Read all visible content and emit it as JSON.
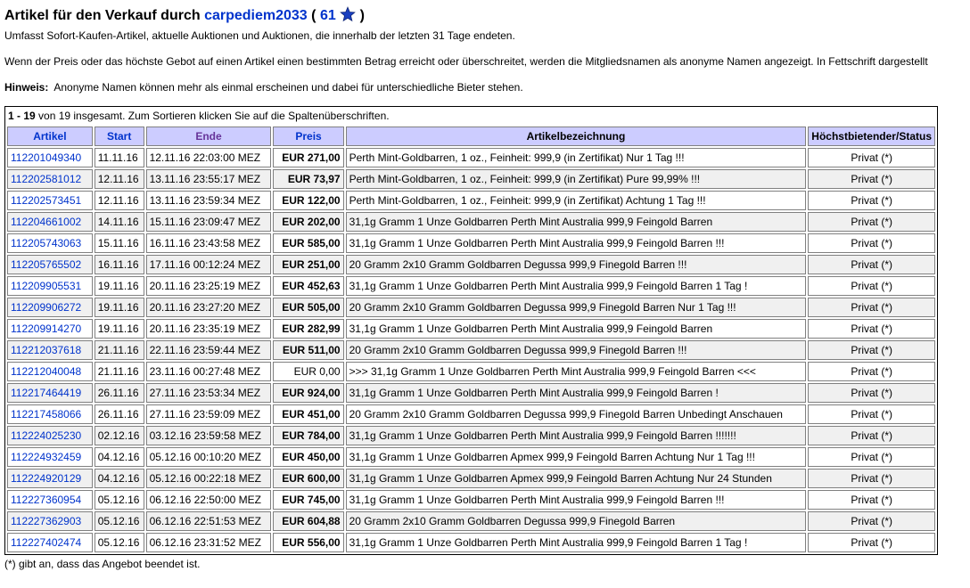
{
  "header": {
    "title_prefix": "Artikel für den Verkauf durch",
    "seller": "carpediem2033",
    "open_paren": "(",
    "rating": "61",
    "close_paren": ")",
    "star_color": "#1a3fbf"
  },
  "intro": "Umfasst Sofort-Kaufen-Artikel, aktuelle Auktionen und Auktionen, die innerhalb der letzten 31 Tage endeten.",
  "info_text": "Wenn der Preis oder das höchste Gebot auf einen Artikel einen bestimmten Betrag erreicht oder überschreitet, werden die Mitgliedsnamen als anonyme Namen angezeigt. In Fettschrift dargestellt",
  "hint": {
    "label": "Hinweis:",
    "text": "Anonyme Namen können mehr als einmal erscheinen und dabei für unterschiedliche Bieter stehen."
  },
  "count": {
    "range": "1 - 19",
    "text": "von 19 insgesamt. Zum Sortieren klicken Sie auf die Spaltenüberschriften."
  },
  "columns": {
    "item": "Artikel",
    "start": "Start",
    "end": "Ende",
    "price": "Preis",
    "title": "Artikelbezeichnung",
    "status": "Höchstbietender/Status"
  },
  "rows": [
    {
      "item": "112201049340",
      "start": "11.11.16",
      "end": "12.11.16 22:03:00 MEZ",
      "price": "EUR 271,00",
      "bold": true,
      "title": "Perth Mint-Goldbarren, 1 oz., Feinheit: 999,9 (in Zertifikat) Nur 1 Tag !!!",
      "status": "Privat (*)"
    },
    {
      "item": "112202581012",
      "start": "12.11.16",
      "end": "13.11.16 23:55:17 MEZ",
      "price": "EUR 73,97",
      "bold": true,
      "title": "Perth Mint-Goldbarren, 1 oz., Feinheit: 999,9 (in Zertifikat) Pure 99,99% !!!",
      "status": "Privat (*)"
    },
    {
      "item": "112202573451",
      "start": "12.11.16",
      "end": "13.11.16 23:59:34 MEZ",
      "price": "EUR 122,00",
      "bold": true,
      "title": "Perth Mint-Goldbarren, 1 oz., Feinheit: 999,9 (in Zertifikat) Achtung 1 Tag !!!",
      "status": "Privat (*)"
    },
    {
      "item": "112204661002",
      "start": "14.11.16",
      "end": "15.11.16 23:09:47 MEZ",
      "price": "EUR 202,00",
      "bold": true,
      "title": "31,1g Gramm 1 Unze Goldbarren Perth Mint Australia 999,9 Feingold Barren",
      "status": "Privat (*)"
    },
    {
      "item": "112205743063",
      "start": "15.11.16",
      "end": "16.11.16 23:43:58 MEZ",
      "price": "EUR 585,00",
      "bold": true,
      "title": "31,1g Gramm 1 Unze Goldbarren Perth Mint Australia 999,9 Feingold Barren !!!",
      "status": "Privat (*)"
    },
    {
      "item": "112205765502",
      "start": "16.11.16",
      "end": "17.11.16 00:12:24 MEZ",
      "price": "EUR 251,00",
      "bold": true,
      "title": "20 Gramm 2x10 Gramm Goldbarren Degussa 999,9 Finegold Barren !!!",
      "status": "Privat (*)"
    },
    {
      "item": "112209905531",
      "start": "19.11.16",
      "end": "20.11.16 23:25:19 MEZ",
      "price": "EUR 452,63",
      "bold": true,
      "title": "31,1g Gramm 1 Unze Goldbarren Perth Mint Australia 999,9 Feingold Barren 1 Tag !",
      "status": "Privat (*)"
    },
    {
      "item": "112209906272",
      "start": "19.11.16",
      "end": "20.11.16 23:27:20 MEZ",
      "price": "EUR 505,00",
      "bold": true,
      "title": "20 Gramm 2x10 Gramm Goldbarren Degussa 999,9 Finegold Barren Nur 1 Tag !!!",
      "status": "Privat (*)"
    },
    {
      "item": "112209914270",
      "start": "19.11.16",
      "end": "20.11.16 23:35:19 MEZ",
      "price": "EUR 282,99",
      "bold": true,
      "title": "31,1g Gramm 1 Unze Goldbarren Perth Mint Australia 999,9 Feingold Barren",
      "status": "Privat (*)"
    },
    {
      "item": "112212037618",
      "start": "21.11.16",
      "end": "22.11.16 23:59:44 MEZ",
      "price": "EUR 511,00",
      "bold": true,
      "title": "20 Gramm 2x10 Gramm Goldbarren Degussa 999,9 Finegold Barren !!!",
      "status": "Privat (*)"
    },
    {
      "item": "112212040048",
      "start": "21.11.16",
      "end": "23.11.16 00:27:48 MEZ",
      "price": "EUR 0,00",
      "bold": false,
      "title": ">>> 31,1g Gramm 1 Unze Goldbarren Perth Mint Australia 999,9 Feingold Barren <<<",
      "status": "Privat (*)"
    },
    {
      "item": "112217464419",
      "start": "26.11.16",
      "end": "27.11.16 23:53:34 MEZ",
      "price": "EUR 924,00",
      "bold": true,
      "title": "31,1g Gramm 1 Unze Goldbarren Perth Mint Australia 999,9 Feingold Barren !",
      "status": "Privat (*)"
    },
    {
      "item": "112217458066",
      "start": "26.11.16",
      "end": "27.11.16 23:59:09 MEZ",
      "price": "EUR 451,00",
      "bold": true,
      "title": "20 Gramm 2x10 Gramm Goldbarren Degussa 999,9 Finegold Barren Unbedingt Anschauen",
      "status": "Privat (*)"
    },
    {
      "item": "112224025230",
      "start": "02.12.16",
      "end": "03.12.16 23:59:58 MEZ",
      "price": "EUR 784,00",
      "bold": true,
      "title": "31,1g Gramm 1 Unze Goldbarren Perth Mint Australia 999,9 Feingold Barren !!!!!!!",
      "status": "Privat (*)"
    },
    {
      "item": "112224932459",
      "start": "04.12.16",
      "end": "05.12.16 00:10:20 MEZ",
      "price": "EUR 450,00",
      "bold": true,
      "title": "31,1g Gramm 1 Unze Goldbarren Apmex 999,9 Feingold Barren Achtung Nur 1 Tag !!!",
      "status": "Privat (*)"
    },
    {
      "item": "112224920129",
      "start": "04.12.16",
      "end": "05.12.16 00:22:18 MEZ",
      "price": "EUR 600,00",
      "bold": true,
      "title": "31,1g Gramm 1 Unze Goldbarren Apmex 999,9 Feingold Barren Achtung Nur 24 Stunden",
      "status": "Privat (*)"
    },
    {
      "item": "112227360954",
      "start": "05.12.16",
      "end": "06.12.16 22:50:00 MEZ",
      "price": "EUR 745,00",
      "bold": true,
      "title": "31,1g Gramm 1 Unze Goldbarren Perth Mint Australia 999,9 Feingold Barren !!!",
      "status": "Privat (*)"
    },
    {
      "item": "112227362903",
      "start": "05.12.16",
      "end": "06.12.16 22:51:53 MEZ",
      "price": "EUR 604,88",
      "bold": true,
      "title": "20 Gramm 2x10 Gramm Goldbarren Degussa 999,9 Finegold Barren",
      "status": "Privat (*)"
    },
    {
      "item": "112227402474",
      "start": "05.12.16",
      "end": "06.12.16 23:31:52 MEZ",
      "price": "EUR 556,00",
      "bold": true,
      "title": "31,1g Gramm 1 Unze Goldbarren Perth Mint Australia 999,9 Feingold Barren 1 Tag !",
      "status": "Privat (*)"
    }
  ],
  "footnote": "(*) gibt an, dass das Angebot beendet ist."
}
